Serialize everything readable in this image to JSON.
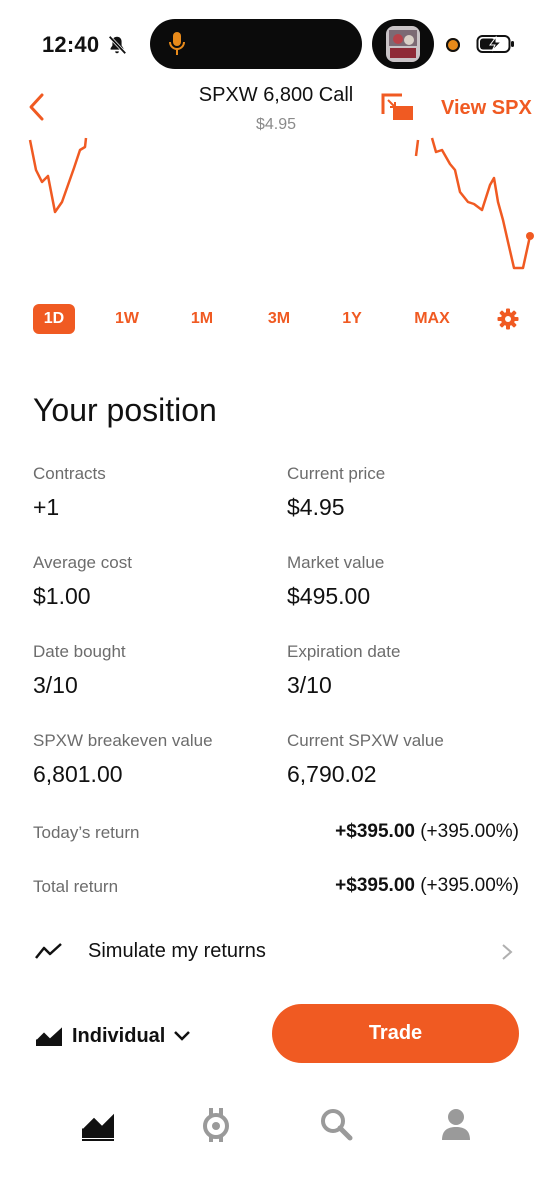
{
  "status_bar": {
    "time": "12:40"
  },
  "header": {
    "title": "SPXW 6,800 Call",
    "subtitle": "$4.95",
    "view_link": "View SPX"
  },
  "colors": {
    "accent": "#f05a22",
    "text": "#111111",
    "muted": "#6c6c6c"
  },
  "ranges": {
    "items": [
      "1D",
      "1W",
      "1M",
      "3M",
      "1Y",
      "MAX"
    ],
    "active": "1D",
    "settings_icon": "gear-icon"
  },
  "position": {
    "title": "Your position",
    "fields": [
      {
        "label": "Contracts",
        "value": "+1"
      },
      {
        "label": "Current price",
        "value": "$4.95"
      },
      {
        "label": "Average cost",
        "value": "$1.00"
      },
      {
        "label": "Market value",
        "value": "$495.00"
      },
      {
        "label": "Date bought",
        "value": "3/10"
      },
      {
        "label": "Expiration date",
        "value": "3/10"
      },
      {
        "label": "SPXW breakeven value",
        "value": "6,801.00"
      },
      {
        "label": "Current SPXW value",
        "value": "6,790.02"
      }
    ],
    "returns": [
      {
        "label": "Today’s return",
        "amount": "+$395.00",
        "percent": "(+395.00%)"
      },
      {
        "label": "Total return",
        "amount": "+$395.00",
        "percent": "(+395.00%)"
      }
    ]
  },
  "simulate": {
    "label": "Simulate my returns"
  },
  "account": {
    "label": "Individual"
  },
  "trade_button": {
    "label": "Trade"
  },
  "tab_bar": {
    "items": [
      "investing-icon",
      "crypto-icon",
      "search-icon",
      "account-icon"
    ],
    "active": "investing-icon"
  }
}
